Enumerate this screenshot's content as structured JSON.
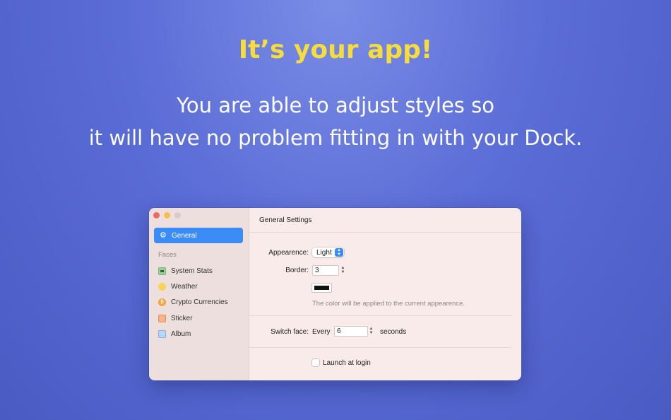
{
  "hero": {
    "headline": "It’s your app!",
    "line1": "You are able to adjust styles so",
    "line2": "it will have no problem fitting in with your Dock."
  },
  "colors": {
    "headline": "#f6dd3c",
    "accent": "#3b8cf5",
    "background": "#5a6cd6"
  },
  "sidebar": {
    "selected": {
      "label": "General",
      "icon": "gear-icon"
    },
    "section_label": "Faces",
    "items": [
      {
        "label": "System Stats",
        "icon": "system-stats-icon"
      },
      {
        "label": "Weather",
        "icon": "weather-icon"
      },
      {
        "label": "Crypto Currencies",
        "icon": "crypto-icon"
      },
      {
        "label": "Sticker",
        "icon": "sticker-icon"
      },
      {
        "label": "Album",
        "icon": "album-icon"
      }
    ]
  },
  "settings": {
    "title": "General Settings",
    "appearance_label": "Appearence:",
    "appearance_value": "Light",
    "border_label": "Border:",
    "border_value": "3",
    "color_value": "#111111",
    "color_note": "The color will be applied to the current appearence.",
    "switch_label": "Switch face:",
    "switch_prefix": "Every",
    "switch_value": "6",
    "switch_suffix": "seconds",
    "launch_label": "Launch at login",
    "launch_checked": false
  }
}
